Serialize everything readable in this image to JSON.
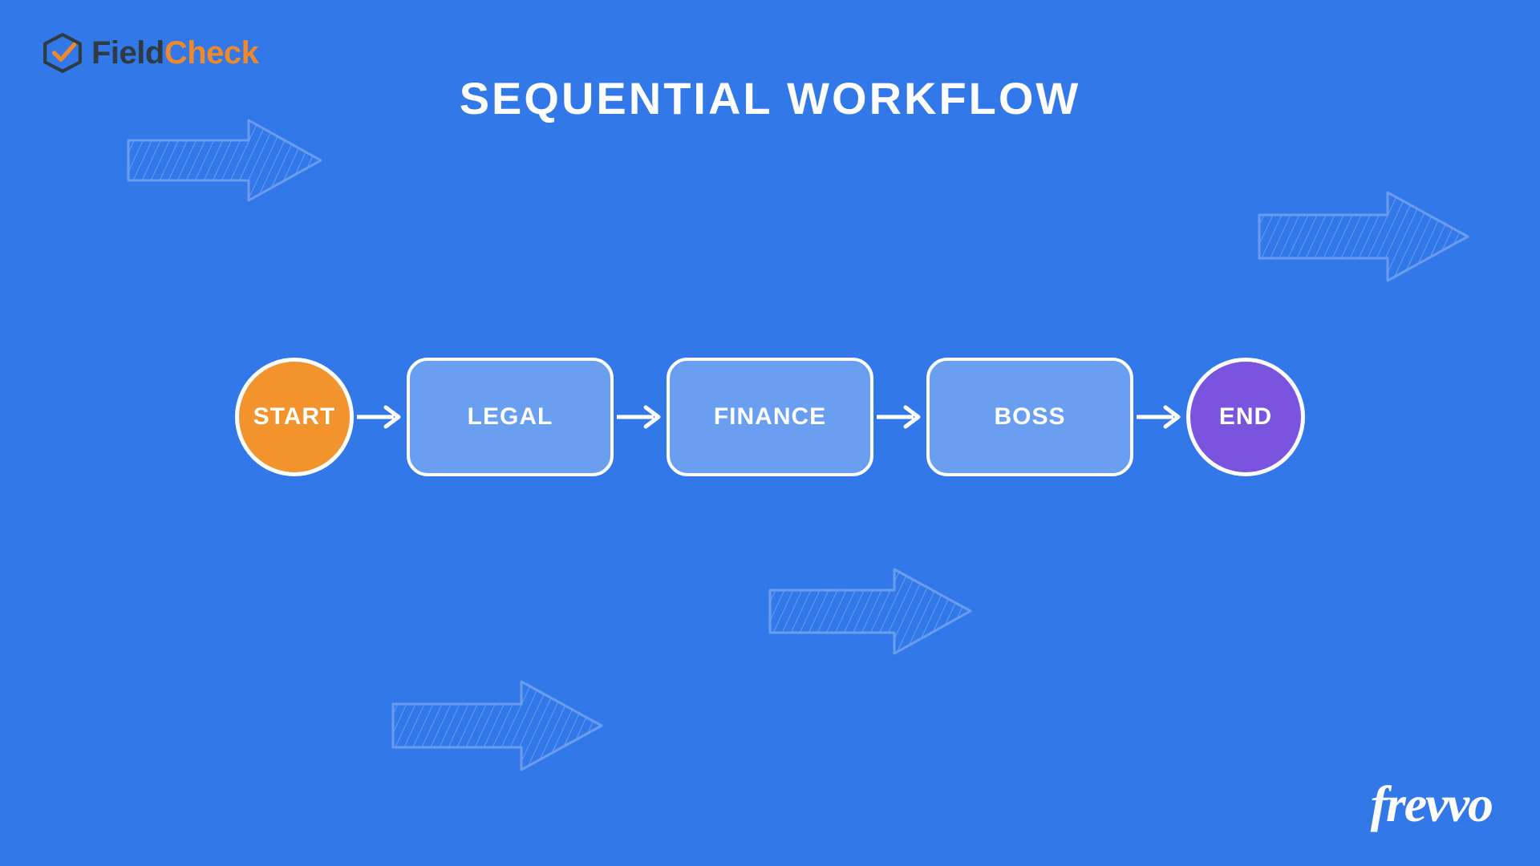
{
  "logos": {
    "fieldcheck_a": "Field",
    "fieldcheck_b": "Check",
    "frevvo": "frevvo"
  },
  "title": "SEQUENTIAL WORKFLOW",
  "workflow": {
    "start": "START",
    "steps": [
      "LEGAL",
      "FINANCE",
      "BOSS"
    ],
    "end": "END"
  },
  "colors": {
    "background": "#3278e8",
    "node_fill": "#6a9ef0",
    "start": "#f2932e",
    "end": "#7a53de",
    "stroke": "#ffffff"
  }
}
